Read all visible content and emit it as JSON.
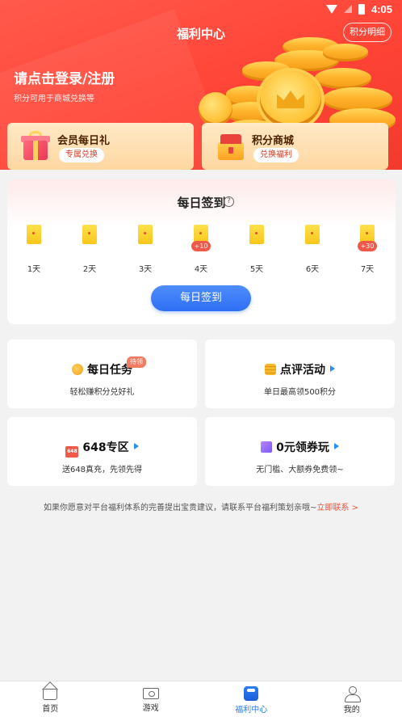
{
  "status_bar": {
    "time": "4:05",
    "icons": [
      "wifi-icon",
      "no-signal-icon",
      "battery-icon"
    ]
  },
  "header": {
    "title": "福利中心",
    "points_detail": "积分明细",
    "login_prompt": "请点击登录/注册",
    "login_subtitle": "积分可用于商城兑换等"
  },
  "entries": [
    {
      "title": "会员每日礼",
      "button": "专属兑换",
      "icon": "gift-icon"
    },
    {
      "title": "积分商城",
      "button": "兑换福利",
      "icon": "treasure-box-icon"
    }
  ],
  "signin": {
    "title": "每日签到",
    "button": "每日签到",
    "days": [
      {
        "label": "1天",
        "bonus": ""
      },
      {
        "label": "2天",
        "bonus": ""
      },
      {
        "label": "3天",
        "bonus": ""
      },
      {
        "label": "4天",
        "bonus": "+10"
      },
      {
        "label": "5天",
        "bonus": ""
      },
      {
        "label": "6天",
        "bonus": ""
      },
      {
        "label": "7天",
        "bonus": "+30"
      }
    ]
  },
  "tasks": [
    {
      "title": "每日任务",
      "subtitle": "轻松赚积分兑好礼",
      "tag": "待领",
      "icon": "medal-icon"
    },
    {
      "title": "点评活动",
      "subtitle": "单日最高领500积分",
      "icon": "coins-icon"
    },
    {
      "title": "648专区",
      "subtitle": "送648真充，先领先得",
      "icon": "648-icon",
      "icon_text": "648"
    },
    {
      "title": "0元领券玩",
      "subtitle": "无门槛、大额券免费领~",
      "icon": "ticket-icon"
    }
  ],
  "feedback": {
    "text": "如果你愿意对平台福利体系的完善提出宝贵建议，请联系平台福利策划亲哦~",
    "link": "立即联系 >"
  },
  "bottom_nav": [
    {
      "label": "首页",
      "icon": "home-icon"
    },
    {
      "label": "游戏",
      "icon": "game-icon"
    },
    {
      "label": "福利中心",
      "icon": "welfare-icon",
      "active": true
    },
    {
      "label": "我的",
      "icon": "profile-icon"
    }
  ],
  "colors": {
    "primary_red": "#ff4436",
    "accent_blue": "#2f6ff4",
    "nav_active": "#2d7cf0"
  }
}
